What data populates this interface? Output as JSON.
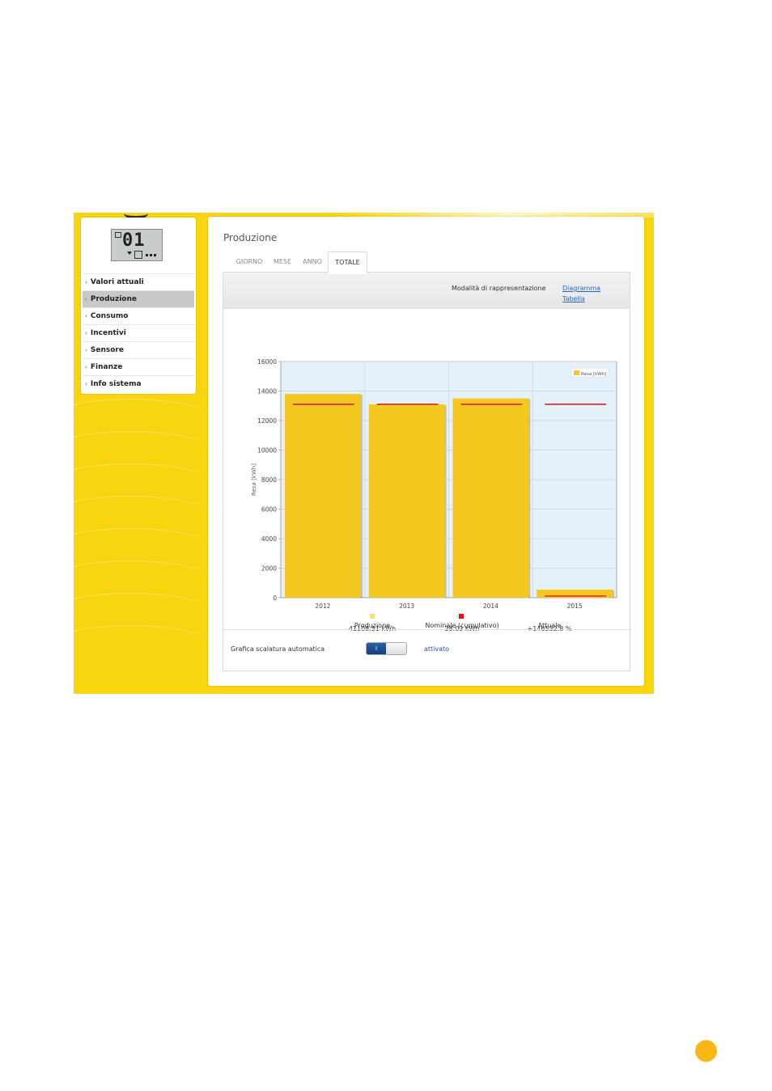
{
  "sidebar": {
    "display_digits": "01",
    "items": [
      {
        "label": "Valori attuali",
        "active": false
      },
      {
        "label": "Produzione",
        "active": true
      },
      {
        "label": "Consumo",
        "active": false
      },
      {
        "label": "Incentivi",
        "active": false
      },
      {
        "label": "Sensore",
        "active": false
      },
      {
        "label": "Finanze",
        "active": false
      },
      {
        "label": "Info sistema",
        "active": false
      }
    ]
  },
  "main": {
    "title": "Produzione",
    "tabs": [
      {
        "label": "GIORNO",
        "active": false
      },
      {
        "label": "MESE",
        "active": false
      },
      {
        "label": "ANNO",
        "active": false
      },
      {
        "label": "TOTALE",
        "active": true
      }
    ],
    "mode_label": "Modalità di rappresentazione",
    "mode_links": [
      "Diagramma",
      "Tabella"
    ],
    "autoscale_label": "Grafica scalatura automatica",
    "toggle_label": "I",
    "toggle_state": "attivato"
  },
  "chart_data": {
    "type": "bar",
    "categories": [
      "2012",
      "2013",
      "2014",
      "2015"
    ],
    "series": [
      {
        "name": "Resa [kWh]",
        "values": [
          13800,
          13100,
          13500,
          550
        ],
        "color": "#f5c81f"
      }
    ],
    "nominal_values": [
      13100,
      13100,
      13100,
      13100
    ],
    "nominal_color": "#e01010",
    "ylabel": "Resa [kWh]",
    "ylim": [
      0,
      16000
    ],
    "yticks": [
      "0",
      "2000",
      "4000",
      "6000",
      "8000",
      "10000",
      "12000",
      "14000",
      "16000"
    ],
    "legend": "Resa [kWh]",
    "legend_position": "top-right",
    "plot_background": "#e4f1fb",
    "grid": true,
    "summary": [
      {
        "label": "Produzione",
        "value": "41108.51 kWh",
        "color": "#f5e36a"
      },
      {
        "label": "Nominale (cumulativo)",
        "value": "28.03 kWh",
        "color": "#e01010"
      },
      {
        "label": "Attuale",
        "value": "+146532.8 %",
        "color": ""
      }
    ]
  },
  "colors": {
    "frame": "#f8d50f",
    "link": "#2a66b8",
    "page_dot": "#f8b814"
  }
}
